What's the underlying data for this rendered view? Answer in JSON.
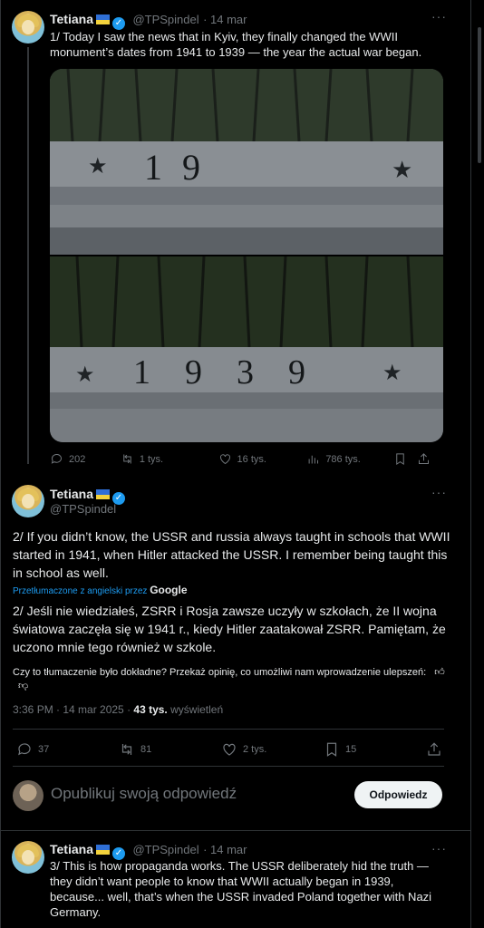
{
  "tweet1": {
    "author": "Tetiana",
    "handle": "@TPSpindel",
    "date": "14 mar",
    "text": "1/ Today I saw the news that in Kyiv, they finally changed the WWII monument’s dates from 1941 to 1939 — the year the actual war began.",
    "photo_top_digits": "19",
    "photo_bottom_digits": "1939",
    "replies": "202",
    "reposts": "1 tys.",
    "likes": "16 tys.",
    "views": "786 tys."
  },
  "tweet2": {
    "author": "Tetiana",
    "handle": "@TPSpindel",
    "text": "2/ If you didn’t know, the USSR and russia always taught in schools that WWII started in 1941, when Hitler attacked the USSR. I remember being taught this in school as well.",
    "translated_by_label": "Przetłumaczone z angielski przez",
    "translated_by_brand": "Google",
    "translation": "2/ Jeśli nie wiedziałeś, ZSRR i Rosja zawsze uczyły w szkołach, że II wojna światowa zaczęła się w 1941 r., kiedy Hitler zaatakował ZSRR. Pamiętam, że uczono mnie tego również w szkole.",
    "feedback": "Czy to tłumaczenie było dokładne? Przekaż opinię, co umożliwi nam wprowadzenie ulepszeń:",
    "timestamp": "3:36 PM · 14 mar 2025 ·",
    "views_count": "43 tys.",
    "views_label": "wyświetleń",
    "replies": "37",
    "reposts": "81",
    "likes": "2 tys.",
    "bookmarks": "15"
  },
  "reply_box": {
    "placeholder": "Opublikuj swoją odpowiedź",
    "button": "Odpowiedz"
  },
  "tweet3": {
    "author": "Tetiana",
    "handle": "@TPSpindel",
    "date": "14 mar",
    "text": "3/ This is how propaganda works. The USSR deliberately hid the truth — they didn’t want people to know that WWII actually began in 1939, because... well, that’s when the USSR invaded Poland together with Nazi Germany."
  },
  "colors": {
    "accent": "#1d9bf0",
    "muted": "#71767b",
    "text": "#e7e9ea",
    "background": "#000000"
  }
}
